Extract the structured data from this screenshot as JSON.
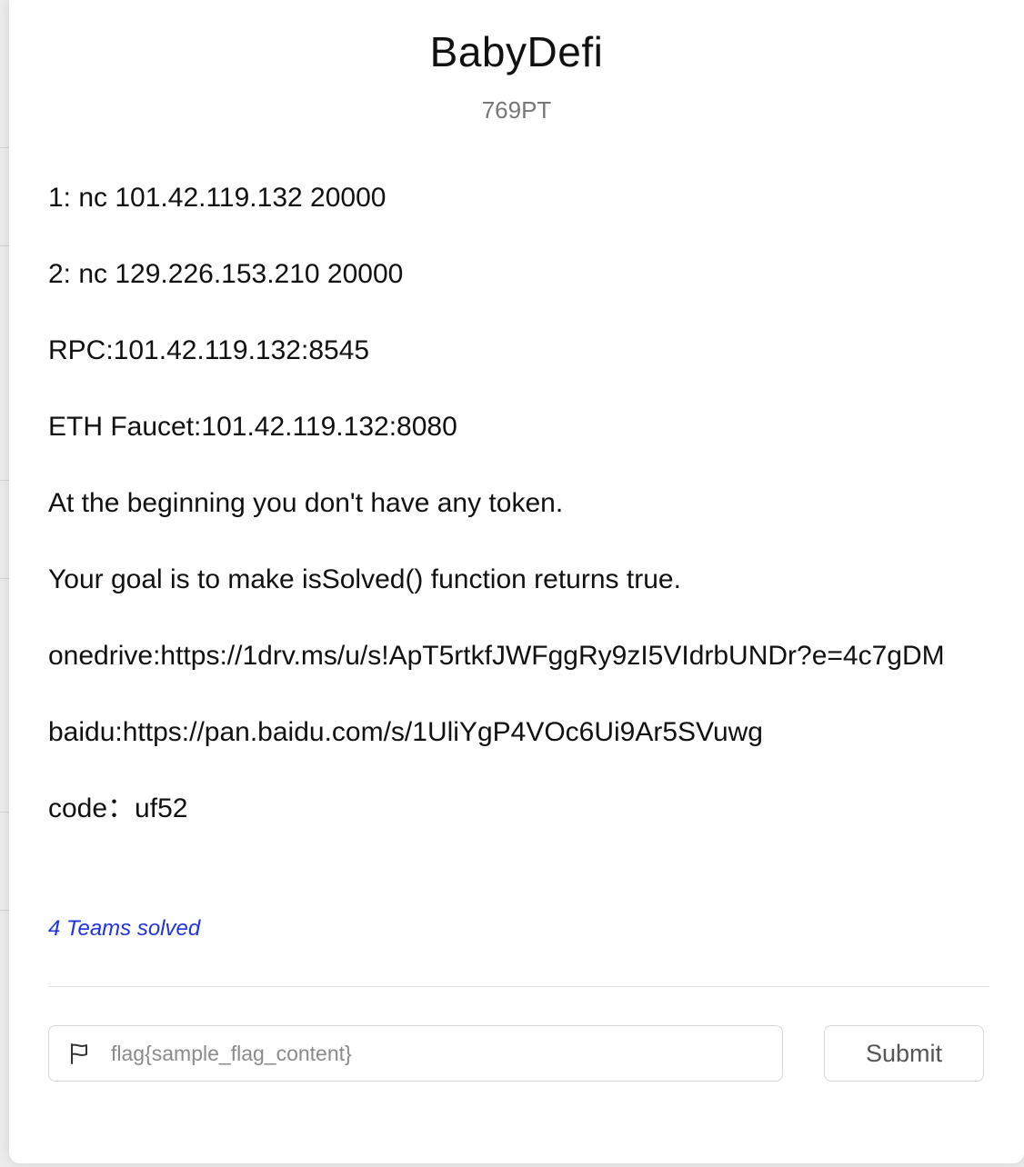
{
  "challenge": {
    "title": "BabyDefi",
    "points": "769PT",
    "description": [
      "1: nc 101.42.119.132 20000",
      "2: nc 129.226.153.210 20000",
      "RPC:101.42.119.132:8545",
      "ETH Faucet:101.42.119.132:8080",
      "At the beginning you don't have any token.",
      "Your goal is to make isSolved() function returns true.",
      "onedrive:https://1drv.ms/u/s!ApT5rtkfJWFggRy9zI5VIdrbUNDr?e=4c7gDM",
      "baidu:https://pan.baidu.com/s/1UliYgP4VOc6Ui9Ar5SVuwg",
      "code：uf52"
    ],
    "solved_text": "4 Teams solved"
  },
  "flag_form": {
    "icon": "flag-icon",
    "placeholder": "flag{sample_flag_content}",
    "value": "",
    "submit_label": "Submit"
  },
  "colors": {
    "link": "#1e32e0",
    "muted": "#777777",
    "border": "#d6d6d6"
  }
}
